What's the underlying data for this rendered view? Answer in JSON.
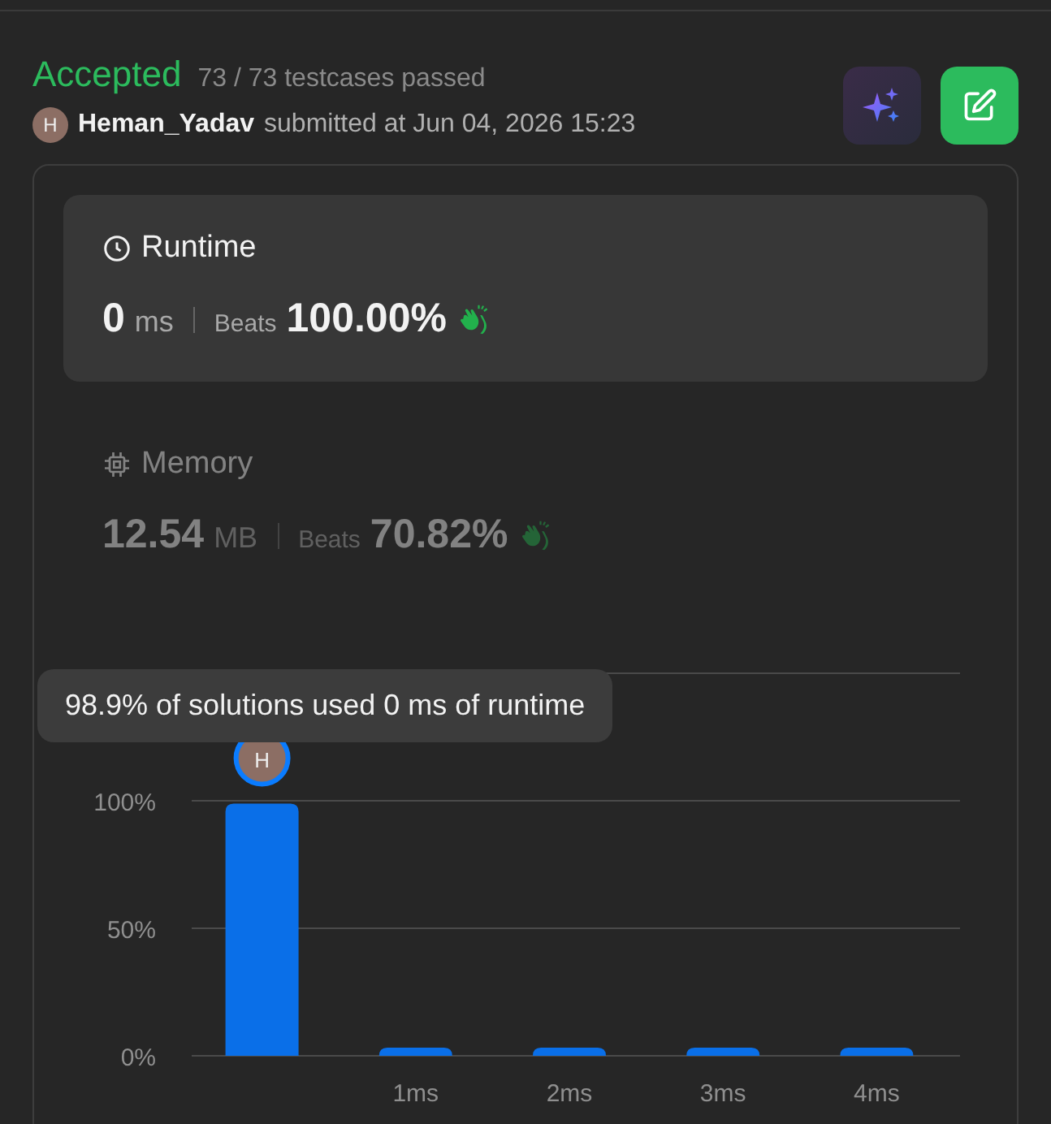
{
  "header": {
    "status": "Accepted",
    "testcases": "73 / 73 testcases passed",
    "avatar_letter": "H",
    "user": "Heman_Yadav",
    "submitted": "submitted at Jun 04, 2026 15:23"
  },
  "metrics": [
    {
      "kind": "runtime",
      "title": "Runtime",
      "value": "0",
      "unit": "ms",
      "beats_label": "Beats",
      "beats": "100.00%",
      "selected": true
    },
    {
      "kind": "memory",
      "title": "Memory",
      "value": "12.54",
      "unit": "MB",
      "beats_label": "Beats",
      "beats": "70.82%",
      "selected": false
    }
  ],
  "chart": {
    "tooltip": "98.9% of solutions used 0 ms of runtime",
    "marker_letter": "H",
    "chart_data": {
      "type": "bar",
      "categories": [
        null,
        "1ms",
        "2ms",
        "3ms",
        "4ms"
      ],
      "series": [
        {
          "color": "#0a6fe8",
          "values": [
            98.9,
            3,
            3,
            3,
            3
          ]
        }
      ],
      "ylim": [
        0,
        150
      ],
      "yticks": [
        {
          "value": 0,
          "label": "0%"
        },
        {
          "value": 50,
          "label": "50%"
        },
        {
          "value": 100,
          "label": "100%"
        }
      ]
    }
  }
}
